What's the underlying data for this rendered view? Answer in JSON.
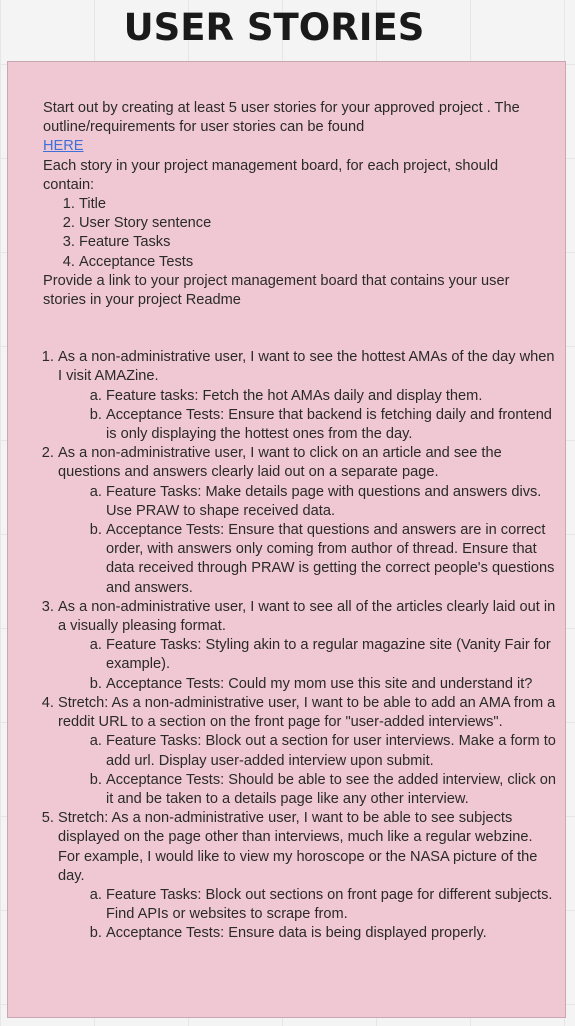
{
  "page": {
    "title": "USER STORIES"
  },
  "intro": {
    "line1": "Start out by creating at least 5 user stories for your approved project . The outline/requirements for user stories can be found",
    "link_text": "HERE",
    "line2": "Each story in your project management board, for each project, should contain:",
    "requirements": [
      "Title",
      "User Story sentence",
      "Feature Tasks",
      "Acceptance Tests"
    ],
    "line3": "Provide a link to your project management board that contains your user stories in your project Readme"
  },
  "stories": [
    {
      "text": "As a non-administrative user, I want to see the hottest AMAs of the day when I visit AMAZine.",
      "sub": [
        "Feature tasks: Fetch the hot AMAs daily and display them.",
        "Acceptance Tests: Ensure that backend is fetching daily and frontend is only displaying the hottest ones from the day."
      ]
    },
    {
      "text": "As a non-administrative user, I want to click on an article and see the questions and answers clearly laid out on a separate page.",
      "sub": [
        "Feature Tasks: Make details page with questions and answers divs. Use PRAW to shape received data.",
        "Acceptance Tests: Ensure that questions and answers are in correct order, with answers only coming from author of thread. Ensure that data received through PRAW is getting the correct people's questions and answers."
      ]
    },
    {
      "text": "As a non-administrative user, I want to see all of the articles clearly laid out in a visually pleasing format.",
      "sub": [
        "Feature Tasks: Styling akin to a regular magazine site (Vanity Fair for example).",
        "Acceptance Tests: Could my mom use this site and understand it?"
      ]
    },
    {
      "text": "Stretch: As a non-administrative user, I want to be able to add an AMA from a reddit URL to a section on the front page for \"user-added interviews\".",
      "sub": [
        "Feature Tasks: Block out a section for user interviews. Make a form to add url. Display user-added interview upon submit.",
        "Acceptance Tests: Should be able to see the added interview, click on it and be taken to a details page like any other interview."
      ]
    },
    {
      "text": "Stretch: As a non-administrative user, I want to be able to see subjects displayed on the page other than interviews, much like a regular webzine. For example, I would like to view my horoscope or the NASA picture of the day.",
      "sub": [
        "Feature Tasks: Block out sections on front page for different subjects. Find APIs or websites to scrape from.",
        "Acceptance Tests: Ensure data is being displayed properly."
      ]
    }
  ]
}
